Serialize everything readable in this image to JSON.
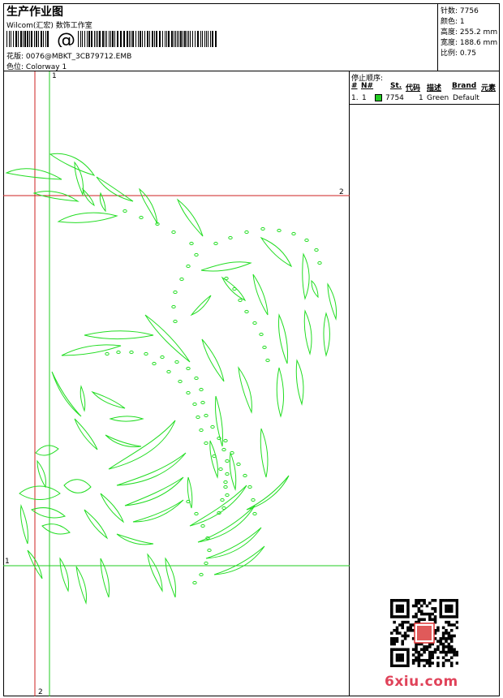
{
  "header": {
    "title": "生产作业图",
    "subtitle": "Wilcom(汇宏) 数饰工作室",
    "at_symbol": "@",
    "design_label": "花版:",
    "design_value": "0076@MBKT_3CB79712.EMB",
    "colorway_label": "色位:",
    "colorway_value": "Colorway 1"
  },
  "stats": [
    {
      "label": "针数:",
      "value": "7756"
    },
    {
      "label": "颜色:",
      "value": "1"
    },
    {
      "label": "高度:",
      "value": "255.2 mm"
    },
    {
      "label": "宽度:",
      "value": "188.6 mm"
    },
    {
      "label": "比例:",
      "value": "0.75"
    }
  ],
  "stop_sequence": {
    "title": "停止顺序:",
    "columns": [
      "#",
      "N#",
      "St.",
      "代码",
      "描述",
      "Brand",
      "元素"
    ],
    "rows": [
      {
        "index": "1.",
        "n": "1",
        "stitches": "7754",
        "code": "1",
        "description": "Green",
        "brand": "Default",
        "color": "#22cc22"
      }
    ]
  },
  "guides": {
    "top_green": "1",
    "right_red": "2",
    "left_green": "1",
    "bottom_red": "2"
  },
  "watermark": {
    "text": "6xiu.com"
  },
  "colors": {
    "stitch": "#22dd22",
    "guide_red": "#cc2222",
    "guide_green": "#22cc22",
    "watermark": "#e0435a"
  }
}
